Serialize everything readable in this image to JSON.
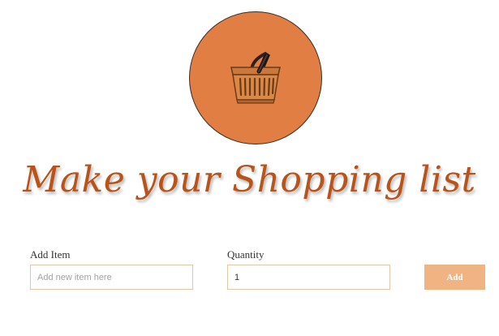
{
  "header": {
    "logo_icon": "shopping-basket-icon",
    "title": "Make your Shopping list"
  },
  "form": {
    "item_label": "Add Item",
    "item_placeholder": "Add new item here",
    "item_value": "",
    "quantity_label": "Quantity",
    "quantity_value": "1",
    "add_button_label": "Add"
  },
  "colors": {
    "brand_orange": "#e07e44",
    "title_color": "#b8541a",
    "button_bg": "#f0b483",
    "input_border": "#e3c6a6"
  }
}
